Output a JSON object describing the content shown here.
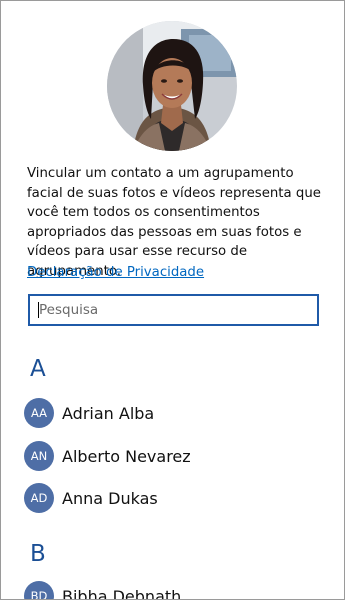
{
  "profile": {
    "photo": "user-portrait-photo"
  },
  "description": "Vincular um contato a um agrupamento facial de suas fotos e vídeos representa que você tem todos os consentimentos apropriados das pessoas em suas fotos e vídeos para usar esse recurso de agrupamento.",
  "privacy_link": "Declaração de Privacidade",
  "search": {
    "placeholder": "Pesquisa",
    "value": ""
  },
  "groups": [
    {
      "letter": "A",
      "contacts": [
        {
          "initials": "AA",
          "name": "Adrian Alba"
        },
        {
          "initials": "AN",
          "name": "Alberto Nevarez"
        },
        {
          "initials": "AD",
          "name": "Anna Dukas"
        }
      ]
    },
    {
      "letter": "B",
      "contacts": [
        {
          "initials": "BD",
          "name": "Bibha Debnath"
        }
      ]
    }
  ],
  "colors": {
    "accent": "#1b4f95",
    "link": "#0067c0",
    "avatar_bg": "#4e6ea6",
    "search_border": "#1f5aa8"
  }
}
